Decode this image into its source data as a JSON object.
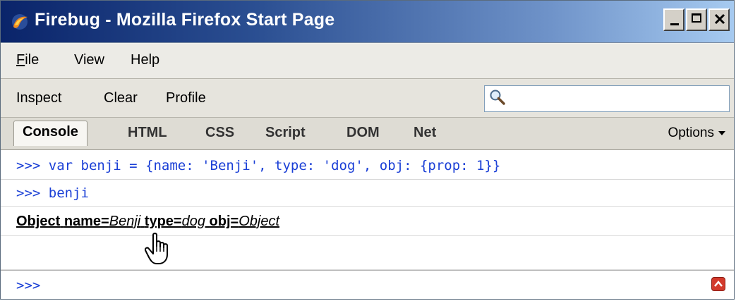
{
  "window": {
    "title": "Firebug - Mozilla Firefox Start Page"
  },
  "menubar": {
    "items": [
      {
        "mnemonic": "F",
        "rest": "ile"
      },
      {
        "mnemonic": "",
        "rest": "View"
      },
      {
        "mnemonic": "",
        "rest": "Help"
      }
    ]
  },
  "toolbar": {
    "inspect_label": "Inspect",
    "clear_label": "Clear",
    "profile_label": "Profile",
    "search_value": ""
  },
  "tabs": {
    "items": [
      "Console",
      "HTML",
      "CSS",
      "Script",
      "DOM",
      "Net"
    ],
    "active": "Console",
    "options_label": "Options"
  },
  "console": {
    "lines": [
      ">>> var benji = {name: 'Benji', type: 'dog', obj: {prop: 1}}",
      ">>> benji"
    ],
    "result": {
      "prefix": "Object",
      "parts": [
        {
          "key": "name=",
          "value": "Benji"
        },
        {
          "key": "type=",
          "value": "dog"
        },
        {
          "key": "obj=",
          "value": "Object"
        }
      ]
    },
    "prompt": ">>>"
  },
  "colors": {
    "code": "#1a3fd6",
    "titlebar_start": "#0a246a",
    "titlebar_end": "#a6caf0"
  },
  "icons": {
    "app": "firefox-icon",
    "search": "magnifier-icon",
    "expand": "expand-up-icon",
    "cursor": "hand-pointer-icon"
  }
}
